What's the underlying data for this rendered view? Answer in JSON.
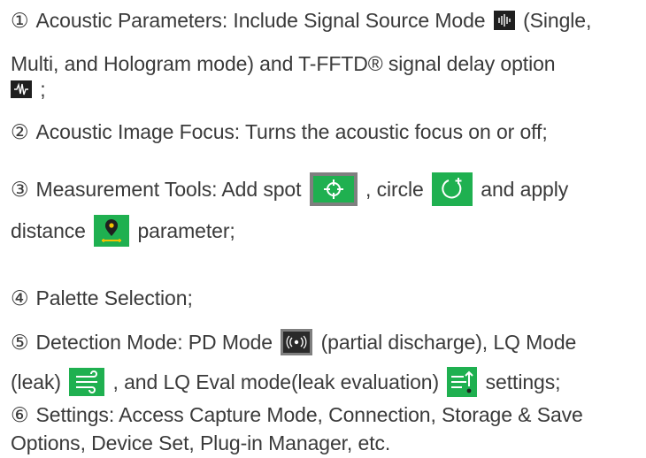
{
  "items": [
    {
      "marker": "①",
      "text_a": "Acoustic Parameters: Include Signal Source Mode",
      "text_b": "(Single,",
      "text_c": "Multi, and Hologram mode) and T-FFTD® signal delay option",
      "text_d": ";",
      "icons": [
        "signal-source-mode-icon",
        "signal-delay-icon"
      ]
    },
    {
      "marker": "②",
      "text_a": "Acoustic Image Focus: Turns the acoustic focus on or off;"
    },
    {
      "marker": "③",
      "text_a": "Measurement Tools: Add spot",
      "text_b": ", circle",
      "text_c": "and apply",
      "text_d": "distance",
      "text_e": "parameter;",
      "icons": [
        "spot-crosshair-icon",
        "circle-add-icon",
        "distance-pin-icon"
      ]
    },
    {
      "marker": "④",
      "text_a": "Palette Selection;"
    },
    {
      "marker": "⑤",
      "text_a": "Detection Mode: PD Mode",
      "text_b": "(partial discharge), LQ Mode",
      "text_c": "(leak)",
      "text_d": ", and LQ Eval mode(leak evaluation)",
      "text_e": "settings;",
      "icons": [
        "pd-mode-icon",
        "lq-mode-icon",
        "lq-eval-mode-icon"
      ]
    },
    {
      "marker": "⑥",
      "text_a": "Settings: Access Capture Mode, Connection, Storage & Save",
      "text_b": "Options, Device Set, Plug-in Manager, etc."
    }
  ],
  "colors": {
    "text": "#3a3a3a",
    "icon_dark": "#1f1f1f",
    "icon_gray": "#7f7f7f",
    "icon_green": "#1fb050",
    "icon_yellow": "#f2c200"
  }
}
